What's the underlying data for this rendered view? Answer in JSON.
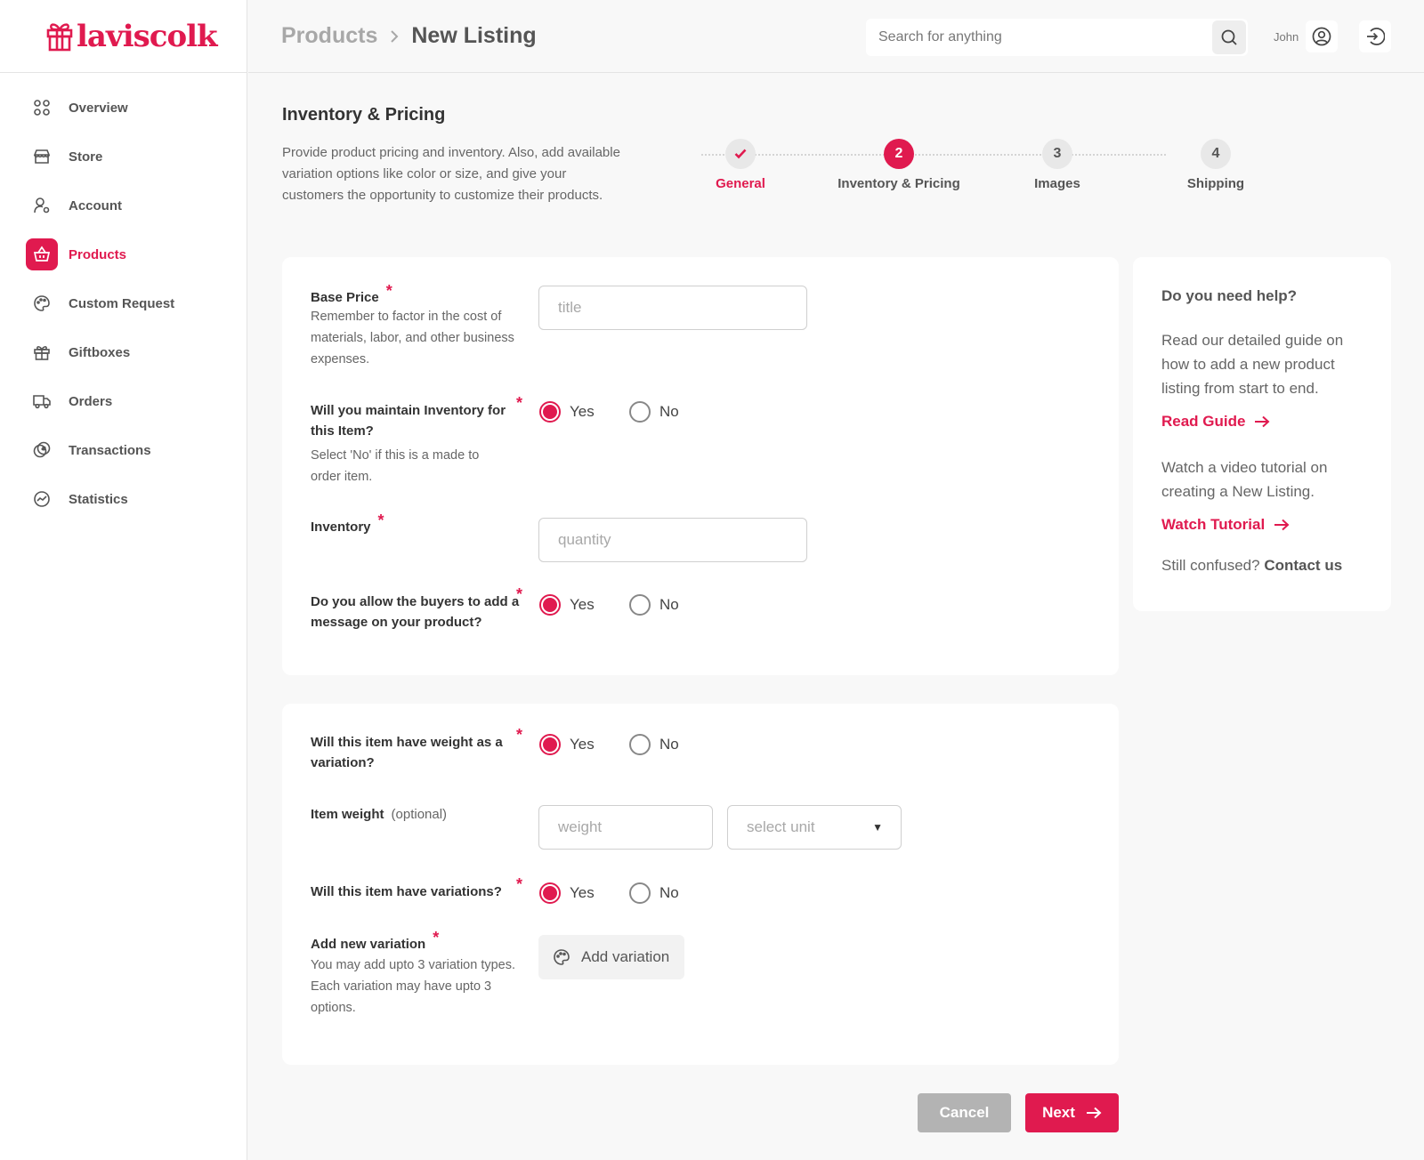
{
  "brand": {
    "name": "laviscolk",
    "accent": "#e01a4f"
  },
  "sidebar": {
    "items": [
      {
        "label": "Overview",
        "icon": "grid-icon"
      },
      {
        "label": "Store",
        "icon": "store-icon"
      },
      {
        "label": "Account",
        "icon": "user-gear-icon"
      },
      {
        "label": "Products",
        "icon": "basket-icon",
        "active": true
      },
      {
        "label": "Custom Request",
        "icon": "palette-icon"
      },
      {
        "label": "Giftboxes",
        "icon": "gift-icon"
      },
      {
        "label": "Orders",
        "icon": "truck-icon"
      },
      {
        "label": "Transactions",
        "icon": "coins-icon"
      },
      {
        "label": "Statistics",
        "icon": "chart-icon"
      }
    ]
  },
  "header": {
    "breadcrumb": [
      "Products",
      "New Listing"
    ],
    "search_placeholder": "Search for anything",
    "user_name": "John"
  },
  "intro": {
    "title": "Inventory & Pricing",
    "description": "Provide product pricing and inventory. Also, add available variation options like color or size, and give your customers the opportunity to customize their products."
  },
  "stepper": {
    "steps": [
      {
        "number": "",
        "label": "General",
        "state": "done"
      },
      {
        "number": "2",
        "label": "Inventory & Pricing",
        "state": "current"
      },
      {
        "number": "3",
        "label": "Images",
        "state": "pending"
      },
      {
        "number": "4",
        "label": "Shipping",
        "state": "pending"
      }
    ]
  },
  "form": {
    "required_mark": "*",
    "yes_label": "Yes",
    "no_label": "No",
    "base_price": {
      "label": "Base Price",
      "help": "Remember to factor in the cost of materials, labor, and other business expenses.",
      "placeholder": "title",
      "value": ""
    },
    "maintain_inventory": {
      "label": "Will you maintain Inventory for this Item?",
      "help": "Select 'No' if this is a made to order item.",
      "selected": "Yes"
    },
    "inventory": {
      "label": "Inventory",
      "placeholder": "quantity",
      "value": ""
    },
    "buyer_message": {
      "label": "Do you allow the buyers to add a message on your product?",
      "selected": "Yes"
    },
    "weight_variation": {
      "label": "Will this item have weight as a variation?",
      "selected": "Yes"
    },
    "item_weight": {
      "label": "Item weight",
      "optional": "(optional)",
      "placeholder": "weight",
      "unit_placeholder": "select unit"
    },
    "variations": {
      "label": "Will this item have variations?",
      "selected": "Yes"
    },
    "add_variation": {
      "label": "Add new variation",
      "help": "You may add upto 3 variation types. Each variation may have upto 3 options.",
      "button": "Add variation"
    }
  },
  "help": {
    "title": "Do you need help?",
    "guide_text": "Read our detailed guide on how to add a new product listing from start to end.",
    "guide_link": "Read Guide",
    "video_text": "Watch a video tutorial on creating a New Listing.",
    "video_link": "Watch Tutorial",
    "contact_prefix": "Still confused?",
    "contact_link": "Contact us"
  },
  "actions": {
    "cancel": "Cancel",
    "next": "Next"
  }
}
